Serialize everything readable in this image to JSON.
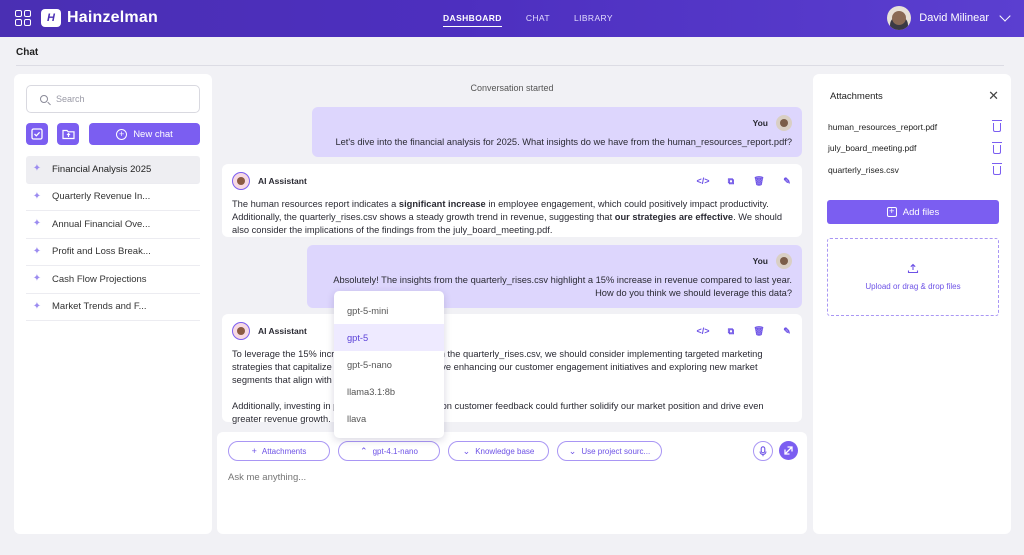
{
  "app": {
    "name": "Hainzelman",
    "logo_mark": "H"
  },
  "nav": {
    "items": [
      "DASHBOARD",
      "CHAT",
      "LIBRARY"
    ],
    "active": "DASHBOARD"
  },
  "user": {
    "name": "David Milinear"
  },
  "page": {
    "title": "Chat"
  },
  "sidebar": {
    "search_placeholder": "Search",
    "new_chat_label": "New chat",
    "chats": [
      "Financial Analysis 2025",
      "Quarterly Revenue In...",
      "Annual Financial Ove...",
      "Profit and Loss Break...",
      "Cash Flow Projections",
      "Market Trends and F..."
    ],
    "active_chat": "Financial Analysis 2025"
  },
  "conversation": {
    "started_label": "Conversation started",
    "messages": [
      {
        "role": "user",
        "sender": "You",
        "text": "Let's dive into the financial analysis for 2025. What insights do we have from the human_resources_report.pdf?"
      },
      {
        "role": "assistant",
        "sender": "AI Assistant",
        "parts": [
          "The human resources report indicates a ",
          "significant increase",
          " in employee engagement, which could positively impact productivity. Additionally, the quarterly_rises.csv shows a steady growth trend in revenue, suggesting that ",
          "our strategies are effective",
          ". We should also consider the implications of the findings from the july_board_meeting.pdf."
        ]
      },
      {
        "role": "user",
        "sender": "You",
        "line1": "Absolutely! The insights from the quarterly_rises.csv highlight a 15% increase in revenue compared to last year.",
        "line2": "How do you think we should leverage this data?"
      },
      {
        "role": "assistant",
        "sender": "AI Assistant",
        "p1": "To leverage the 15% incre                                   d in the quarterly_rises.csv, we should consider implementing targeted marketing strategies that capitalize                                   involve enhancing our customer engagement initiatives and exploring new market segments that align with",
        "p2": "Additionally, investing in p                                   ed on customer feedback could further solidify our market position and drive even greater revenue growth."
      }
    ]
  },
  "composer": {
    "attachments_label": "Attachments",
    "model_label": "gpt-4.1-nano",
    "knowledge_label": "Knowledge base",
    "project_label": "Use project sourc...",
    "placeholder": "Ask me anything..."
  },
  "model_dropdown": {
    "options": [
      "gpt-5-mini",
      "gpt-5",
      "gpt-5-nano",
      "llama3.1:8b",
      "llava"
    ],
    "highlighted": "gpt-5"
  },
  "attachments_panel": {
    "title": "Attachments",
    "files": [
      "human_resources_report.pdf",
      "july_board_meeting.pdf",
      "quarterly_rises.csv"
    ],
    "add_files_label": "Add files",
    "dropzone_label": "Upload or drag & drop files"
  },
  "colors": {
    "brand": "#4a2fb3",
    "accent": "#7b5ef1",
    "user_bubble": "#ddd6fd"
  },
  "icons": [
    "grid-icon",
    "search-icon",
    "checkbox-icon",
    "folder-upload-icon",
    "plus-circle-icon",
    "sparkle-icon",
    "code-icon",
    "copy-icon",
    "trash-icon",
    "edit-icon",
    "microphone-icon",
    "send-icon",
    "close-icon",
    "upload-icon",
    "chevron-down-icon"
  ]
}
